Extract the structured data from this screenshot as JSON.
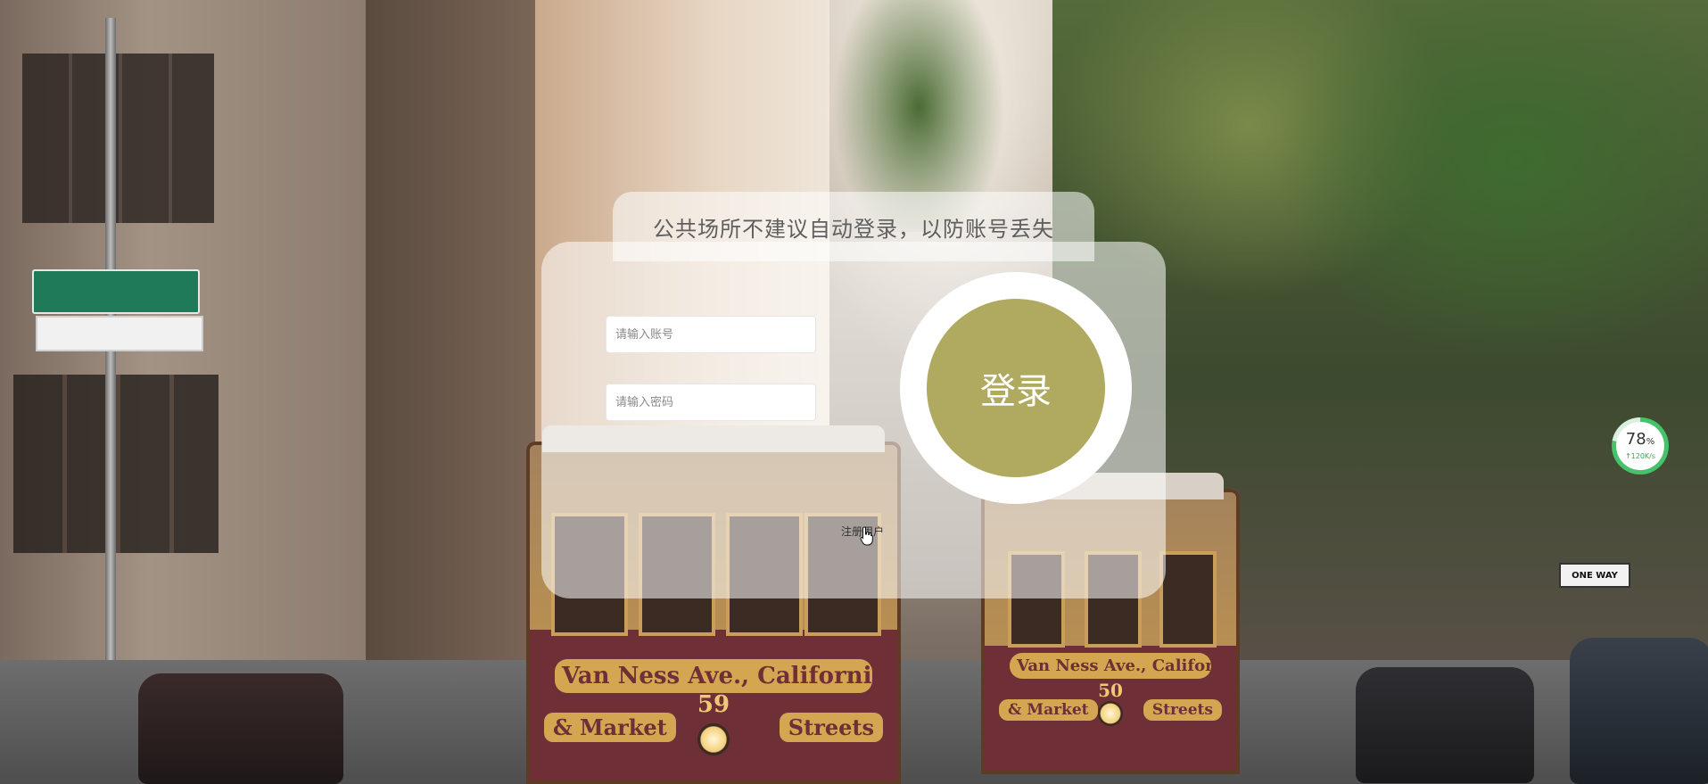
{
  "hint": {
    "text": "公共场所不建议自动登录，以防账号丢失"
  },
  "login": {
    "account_placeholder": "请输入账号",
    "password_placeholder": "请输入密码",
    "submit_label": "登录",
    "register_label": "注册用户"
  },
  "background": {
    "tram_left": {
      "line1": "Van Ness Ave., California",
      "number": "59",
      "line_left": "& Market",
      "line_right": "Streets"
    },
    "tram_right": {
      "line1": "Van Ness Ave., California",
      "number": "50",
      "line_left": "& Market",
      "line_right": "Streets"
    },
    "street_sign": "ONE WAY"
  },
  "speed_widget": {
    "percent": "78",
    "percent_unit": "%",
    "rate": "↑120K/s",
    "progress": 0.78,
    "color": "#45c36b"
  },
  "colors": {
    "login_button": "#b0aa60",
    "panel": "rgba(255,255,255,0.55)"
  }
}
